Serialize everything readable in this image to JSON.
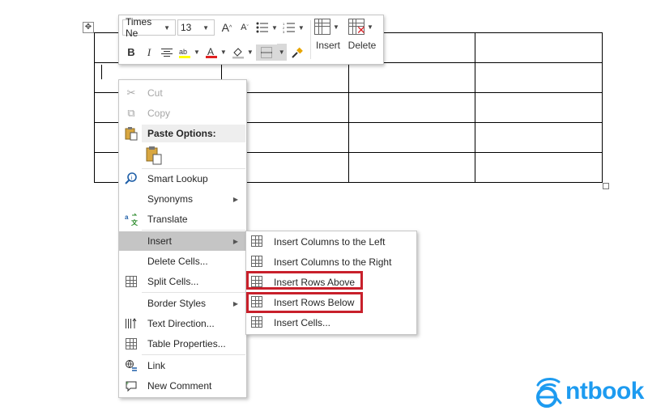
{
  "mini_toolbar": {
    "font_name": "Times Ne",
    "font_size": "13",
    "grow_font": "A",
    "shrink_font": "A",
    "bold": "B",
    "italic": "I",
    "font_color_letter": "A",
    "insert_label": "Insert",
    "delete_label": "Delete"
  },
  "context_menu": {
    "cut": "Cut",
    "copy": "Copy",
    "paste_options": "Paste Options:",
    "smart_lookup": "Smart Lookup",
    "synonyms": "Synonyms",
    "translate": "Translate",
    "insert": "Insert",
    "delete_cells": "Delete Cells...",
    "split_cells": "Split Cells...",
    "border_styles": "Border Styles",
    "text_direction": "Text Direction...",
    "table_properties": "Table Properties...",
    "link": "Link",
    "new_comment": "New Comment"
  },
  "insert_submenu": {
    "columns_left": "Insert Columns to the Left",
    "columns_right": "Insert Columns to the Right",
    "rows_above": "Insert Rows Above",
    "rows_below": "Insert Rows Below",
    "cells": "Insert Cells..."
  },
  "logo": {
    "text": "ntbook"
  },
  "colors": {
    "highlight_red": "#c8202b",
    "logo_blue": "#1d9bf0",
    "font_color_bar": "#e02020",
    "highlighter_bar": "#ffff00"
  }
}
